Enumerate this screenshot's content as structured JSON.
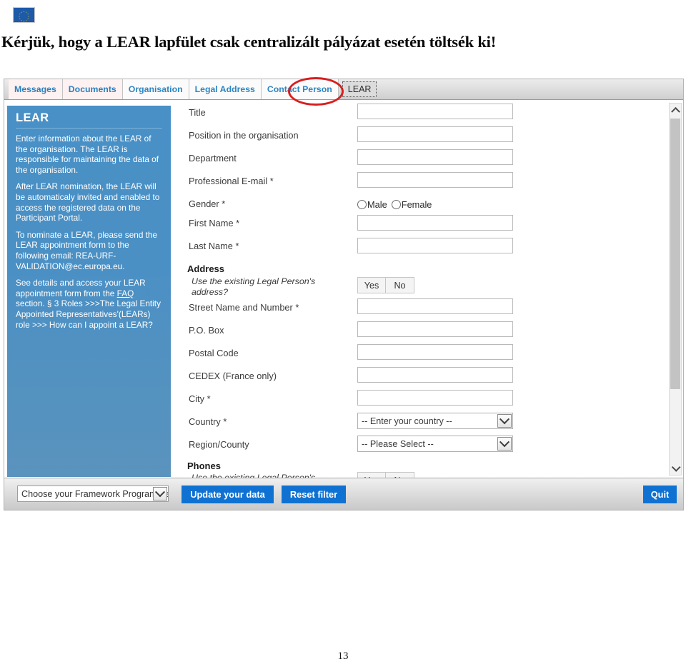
{
  "document": {
    "headline": "Kérjük, hogy a LEAR lapfület csak centralizált pályázat esetén töltsék ki!",
    "page_number": "13",
    "logo_alt": "eu-flag"
  },
  "colors": {
    "accent_blue": "#0f72d2",
    "panel_blue": "#4890c6",
    "tab_link": "#2a7fbf",
    "tab_highlight_bg": "#fdf1f1",
    "annotation_red": "#d81f20"
  },
  "tabs": [
    {
      "label": "Messages",
      "state": "flagged"
    },
    {
      "label": "Documents",
      "state": "flagged"
    },
    {
      "label": "Organisation",
      "state": "normal"
    },
    {
      "label": "Legal Address",
      "state": "normal"
    },
    {
      "label": "Contact Person",
      "state": "normal"
    },
    {
      "label": "LEAR",
      "state": "active"
    }
  ],
  "help_panel": {
    "title": "LEAR",
    "paragraphs": [
      "Enter information about the LEAR of the organisation. The LEAR is responsible for maintaining the data of the organisation.",
      "After LEAR nomination, the LEAR will be automaticaly invited and enabled to access the registered data on the Participant Portal.",
      "To nominate a LEAR, please send the LEAR appointment form to the following email: REA-URF-VALIDATION@ec.europa.eu."
    ],
    "last_paragraph_prefix": "See details and access your LEAR appointment form from the ",
    "last_paragraph_link": "FAQ",
    "last_paragraph_suffix": " section. § 3 Roles >>>The Legal Entity Appointed Representatives'(LEARs) role >>> How can I appoint a LEAR?"
  },
  "form": {
    "person_fields": [
      {
        "label": "Title",
        "required": false,
        "control": "text",
        "value": ""
      },
      {
        "label": "Position in the organisation",
        "required": false,
        "control": "text",
        "value": ""
      },
      {
        "label": "Department",
        "required": false,
        "control": "text",
        "value": ""
      },
      {
        "label": "Professional E-mail",
        "required": true,
        "control": "text",
        "value": ""
      }
    ],
    "gender": {
      "label": "Gender",
      "required": true,
      "options": [
        "Male",
        "Female"
      ],
      "selected": ""
    },
    "name_fields": [
      {
        "label": "First Name",
        "required": true,
        "control": "text",
        "value": ""
      },
      {
        "label": "Last Name",
        "required": true,
        "control": "text",
        "value": ""
      }
    ],
    "address_section": {
      "heading": "Address",
      "reuse_question": "Use the existing Legal Person's address?",
      "reuse_options": [
        "Yes",
        "No"
      ],
      "fields": [
        {
          "label": "Street Name and Number",
          "required": true,
          "control": "text",
          "value": ""
        },
        {
          "label": "P.O. Box",
          "required": false,
          "control": "text",
          "value": ""
        },
        {
          "label": "Postal Code",
          "required": false,
          "control": "text",
          "value": ""
        },
        {
          "label": "CEDEX (France only)",
          "required": false,
          "control": "text",
          "value": ""
        },
        {
          "label": "City",
          "required": true,
          "control": "text",
          "value": ""
        }
      ],
      "country": {
        "label": "Country",
        "required": true,
        "control": "select",
        "value": "-- Enter your country --"
      },
      "region": {
        "label": "Region/County",
        "required": false,
        "control": "select",
        "value": "-- Please Select --"
      }
    },
    "phones_section": {
      "heading": "Phones",
      "reuse_question": "Use the existing Legal Person's",
      "reuse_options": [
        "Yes",
        "No"
      ]
    }
  },
  "toolbar": {
    "framework_select_value": "Choose your Framework Programme",
    "update_label": "Update your data",
    "reset_label": "Reset filter",
    "quit_label": "Quit"
  },
  "scrollbar": {
    "up_icon": "chevron-up-icon",
    "down_icon": "chevron-down-icon"
  }
}
